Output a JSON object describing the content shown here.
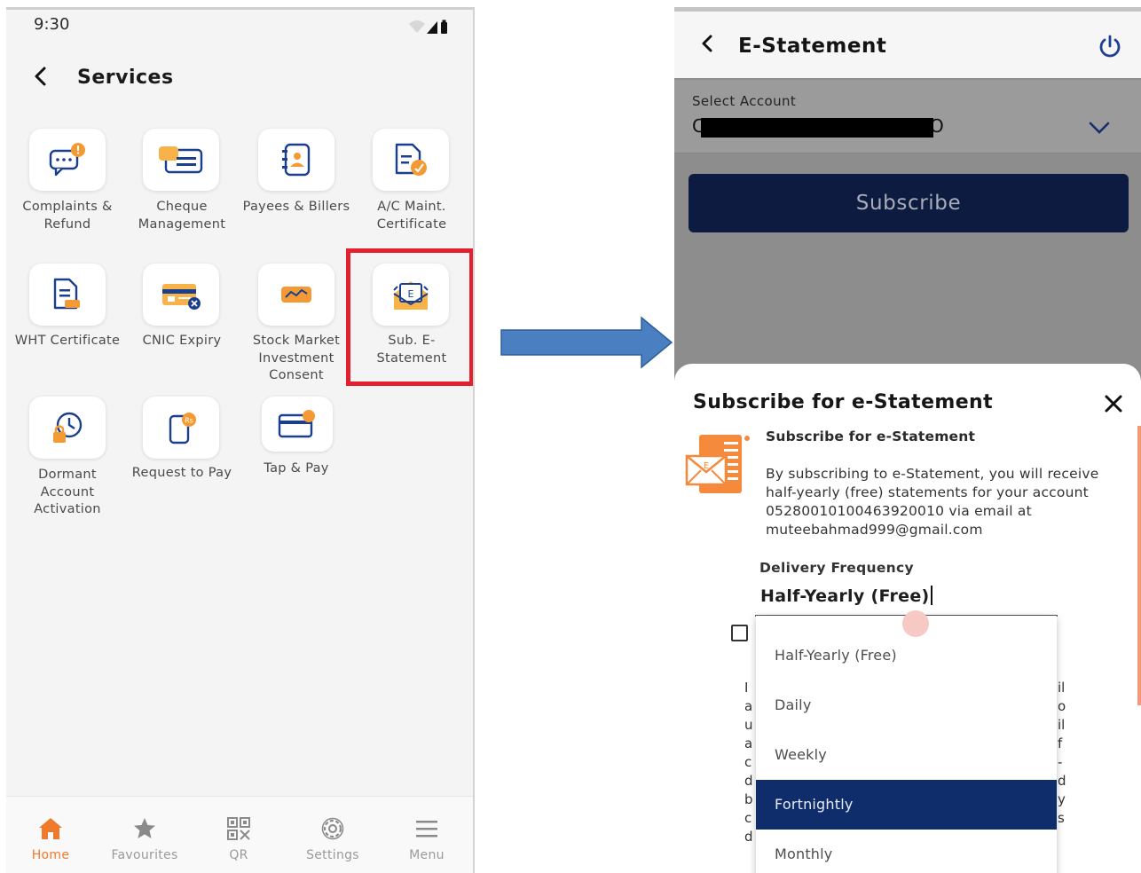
{
  "left_screen": {
    "status_time": "9:30",
    "header": {
      "back_icon": "chevron-left-icon",
      "title": "Services"
    },
    "services": [
      {
        "label": "Complaints & Refund",
        "icon": "complaint-chat-icon"
      },
      {
        "label": "Cheque Management",
        "icon": "cheque-icon"
      },
      {
        "label": "Payees & Billers",
        "icon": "payee-contact-icon"
      },
      {
        "label": "A/C Maint. Certificate",
        "icon": "certificate-doc-icon"
      },
      {
        "label": "WHT Certificate",
        "icon": "wht-doc-icon"
      },
      {
        "label": "CNIC Expiry",
        "icon": "id-card-icon"
      },
      {
        "label": "Stock Market Investment Consent",
        "icon": "stock-wallet-icon"
      },
      {
        "label": "Sub. E-Statement",
        "icon": "e-statement-envelope-icon"
      },
      {
        "label": "Dormant Account Activation",
        "icon": "dormant-clock-icon"
      },
      {
        "label": "Request to Pay",
        "icon": "request-pay-phone-icon"
      },
      {
        "label": "Tap & Pay",
        "icon": "tap-pay-card-icon"
      }
    ],
    "bottom_nav": [
      {
        "label": "Home",
        "icon": "home-icon",
        "active": true
      },
      {
        "label": "Favourites",
        "icon": "star-icon",
        "active": false
      },
      {
        "label": "QR",
        "icon": "qr-icon",
        "active": false
      },
      {
        "label": "Settings",
        "icon": "gear-icon",
        "active": false
      },
      {
        "label": "Menu",
        "icon": "hamburger-menu-icon",
        "active": false
      }
    ],
    "colors": {
      "accent_orange": "#f07a2b",
      "highlight_red": "#e5202e"
    }
  },
  "right_screen": {
    "header": {
      "back_icon": "chevron-left-icon",
      "title": "E-Statement",
      "power_icon": "power-icon"
    },
    "account": {
      "label": "Select Account",
      "value_prefix": "C",
      "value_suffix": "O"
    },
    "subscribe_button": "Subscribe",
    "sheet": {
      "title": "Subscribe for e-Statement",
      "info_title": "Subscribe for e-Statement",
      "info_body": "By subscribing to e-Statement, you will receive half-yearly (free) statements for your account 05280010100463920010 via email at muteebahmad999@gmail.com",
      "frequency_label": "Delivery Frequency",
      "frequency_value": "Half-Yearly (Free)",
      "frequency_options": [
        "Half-Yearly (Free)",
        "Daily",
        "Weekly",
        "Fortnightly",
        "Monthly"
      ],
      "highlighted_option": "Fortnightly",
      "terms_left_fragments": [
        "I",
        "a",
        "u",
        "a",
        "c",
        "d",
        "b",
        "c",
        "d"
      ],
      "terms_right_fragments": [
        "il",
        "o",
        "il",
        "f",
        "-",
        "d",
        "y",
        "s"
      ]
    },
    "colors": {
      "primary_navy": "#0d1b40",
      "dropdown_selected": "#0f2d6b"
    }
  }
}
